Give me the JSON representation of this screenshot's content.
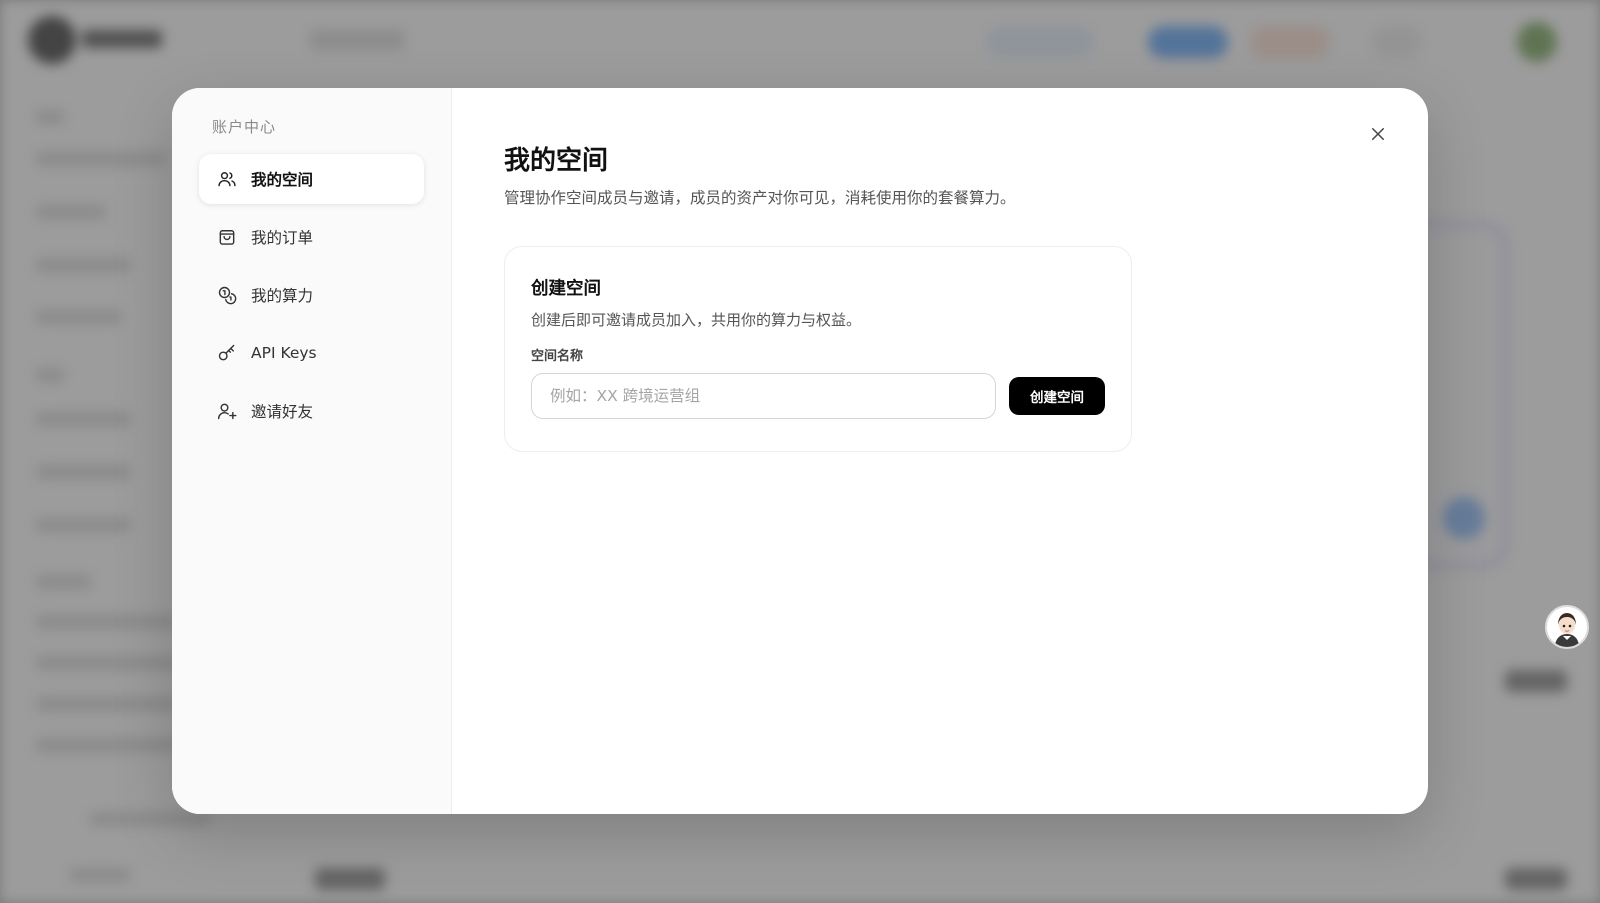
{
  "modal": {
    "sidebar_heading": "账户中心",
    "nav": [
      {
        "label": "我的空间",
        "icon": "users-icon",
        "active": true
      },
      {
        "label": "我的订单",
        "icon": "shopping-bag-icon",
        "active": false
      },
      {
        "label": "我的算力",
        "icon": "coins-icon",
        "active": false
      },
      {
        "label": "API Keys",
        "icon": "key-icon",
        "active": false
      },
      {
        "label": "邀请好友",
        "icon": "user-plus-icon",
        "active": false
      }
    ],
    "close_icon": "close-icon"
  },
  "main": {
    "title": "我的空间",
    "subtitle": "管理协作空间成员与邀请，成员的资产对你可见，消耗使用你的套餐算力。",
    "create_card": {
      "title": "创建空间",
      "description": "创建后即可邀请成员加入，共用你的算力与权益。",
      "field_label": "空间名称",
      "input_value": "",
      "input_placeholder": "例如：XX 跨境运营组",
      "button_label": "创建空间"
    }
  },
  "colors": {
    "primary_button": "#000000",
    "overlay": "#646464",
    "modal_bg": "#ffffff",
    "sidebar_bg": "#fafafa"
  }
}
